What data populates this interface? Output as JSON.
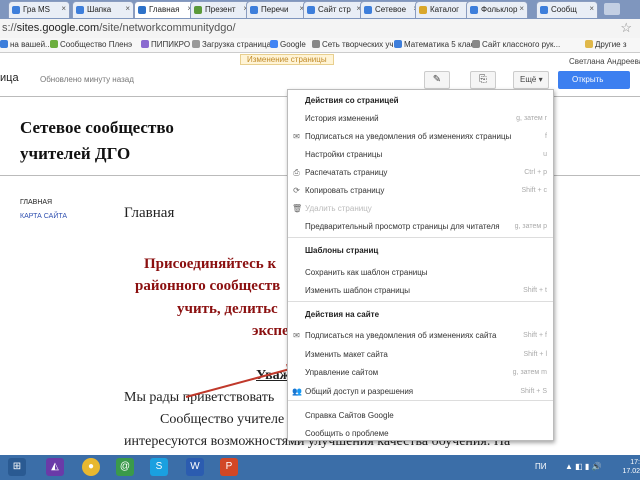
{
  "browser": {
    "tabs": [
      {
        "label": "Гра MS",
        "color": "#3d7edb"
      },
      {
        "label": "Шапка",
        "color": "#3d7edb"
      },
      {
        "label": "Главная",
        "color": "#2e72c9",
        "active": true
      },
      {
        "label": "Презент",
        "color": "#5b9a3a"
      },
      {
        "label": "Перечи",
        "color": "#3d7edb"
      },
      {
        "label": "Сайт стр",
        "color": "#3d7edb"
      },
      {
        "label": "Сетевое",
        "color": "#3d7edb"
      },
      {
        "label": "Каталог",
        "color": "#d9a72b"
      },
      {
        "label": "Фольклор",
        "color": "#3d7edb"
      },
      {
        "label": "Сообщ",
        "color": "#3d7edb"
      }
    ],
    "url_prefix": "s://",
    "url_host": "sites.google.com",
    "url_path": "/site/networkcommunitydgo/",
    "bookmarks": [
      {
        "label": "на вашей...",
        "color": "#3d7edb"
      },
      {
        "label": "Сообщество Пленэ",
        "color": "#6cae3f"
      },
      {
        "label": "ПИПИКРО",
        "color": "#8a6ad0"
      },
      {
        "label": "Загрузка страница",
        "color": "#999999"
      },
      {
        "label": "Google",
        "color": "#4285f4"
      },
      {
        "label": "Сеть творческих уч",
        "color": "#888888"
      },
      {
        "label": "Математика 5 класс",
        "color": "#3d7edb"
      },
      {
        "label": "Сайт классного рук...",
        "color": "#888888"
      },
      {
        "label": "Другие з",
        "color": "#e0b84a"
      }
    ]
  },
  "user_hint": "Изменение страницы",
  "user_name": "Светлана Андреева",
  "page_label": "ица",
  "edited_text": "Обновлено минуту назад",
  "more_label": "Ещё",
  "share_label": "Открыть доступ",
  "site_title_line1": "Сетевое сообщество",
  "site_title_line2": "учителей ДГО",
  "nav": {
    "main": "ГЛАВНАЯ",
    "map": "КАРТА САЙТА"
  },
  "main_heading": "Главная",
  "red_lines": [
    "Присоединяйтесь к",
    "районного сообществ",
    "учить, делитьс",
    "экспе"
  ],
  "underlined_tail": "Уваж",
  "body_lines": [
    "Мы рады приветствовать",
    "Сообщество учителе",
    "интересуются возможностями улучшения качества обучения. На"
  ],
  "menu": {
    "section1": "Действия со страницей",
    "items1": [
      {
        "label": "История изменений",
        "shortcut": "g, затем r",
        "icon": "",
        "disabled": false
      },
      {
        "label": "Подписаться на уведомления об изменениях страницы",
        "shortcut": "f",
        "icon": "✉",
        "disabled": false
      },
      {
        "label": "Настройки страницы",
        "shortcut": "u",
        "icon": "",
        "disabled": false
      },
      {
        "label": "Распечатать страницу",
        "shortcut": "Ctrl + p",
        "icon": "⎙",
        "disabled": false
      },
      {
        "label": "Копировать страницу",
        "shortcut": "Shift + c",
        "icon": "⟳",
        "disabled": false
      },
      {
        "label": "Удалить страницу",
        "shortcut": "",
        "icon": "🗑",
        "disabled": true
      },
      {
        "label": "Предварительный просмотр страницы для читателя",
        "shortcut": "g, затем p",
        "icon": "",
        "disabled": false
      }
    ],
    "section2": "Шаблоны страниц",
    "items2": [
      {
        "label": "Сохранить как шаблон страницы",
        "shortcut": "",
        "icon": "",
        "disabled": false
      },
      {
        "label": "Изменить шаблон страницы",
        "shortcut": "Shift + t",
        "icon": "",
        "disabled": false
      }
    ],
    "section3": "Действия на сайте",
    "items3": [
      {
        "label": "Подписаться на уведомления об изменениях сайта",
        "shortcut": "Shift + f",
        "icon": "✉",
        "disabled": false
      },
      {
        "label": "Изменить макет сайта",
        "shortcut": "Shift + l",
        "icon": "",
        "disabled": false
      },
      {
        "label": "Управление сайтом",
        "shortcut": "g, затем m",
        "icon": "",
        "disabled": false
      },
      {
        "label": "Общий доступ и разрешения",
        "shortcut": "Shift + S",
        "icon": "👥",
        "disabled": false
      }
    ],
    "items4": [
      {
        "label": "Справка Сайтов Google",
        "shortcut": "",
        "icon": "",
        "disabled": false
      },
      {
        "label": "Сообщить о проблеме",
        "shortcut": "",
        "icon": "",
        "disabled": false
      }
    ]
  },
  "taskbar": {
    "lang": "ПИ",
    "time": "17:",
    "date": "17.02"
  }
}
